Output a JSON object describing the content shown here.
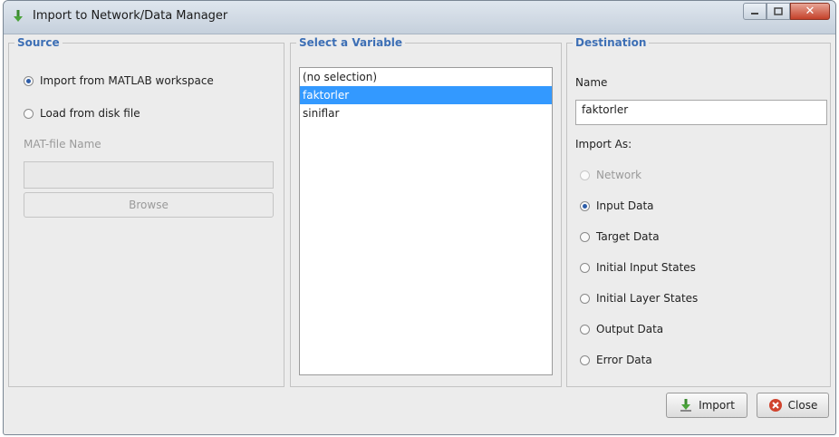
{
  "window": {
    "title": "Import to Network/Data Manager"
  },
  "source": {
    "title": "Source",
    "options": [
      {
        "label": "Import from MATLAB workspace",
        "checked": true
      },
      {
        "label": "Load from disk file",
        "checked": false
      }
    ],
    "matfile_label": "MAT-file Name",
    "matfile_value": "",
    "browse_label": "Browse"
  },
  "variables": {
    "title": "Select a Variable",
    "items": [
      "(no selection)",
      "faktorler",
      "siniflar"
    ],
    "selected": "faktorler"
  },
  "destination": {
    "title": "Destination",
    "name_label": "Name",
    "name_value": "faktorler",
    "import_as_label": "Import As:",
    "options": [
      {
        "label": "Network",
        "checked": false,
        "disabled": true
      },
      {
        "label": "Input Data",
        "checked": true,
        "disabled": false
      },
      {
        "label": "Target Data",
        "checked": false,
        "disabled": false
      },
      {
        "label": "Initial Input States",
        "checked": false,
        "disabled": false
      },
      {
        "label": "Initial Layer States",
        "checked": false,
        "disabled": false
      },
      {
        "label": "Output Data",
        "checked": false,
        "disabled": false
      },
      {
        "label": "Error Data",
        "checked": false,
        "disabled": false
      }
    ]
  },
  "buttons": {
    "import_label": "Import",
    "close_label": "Close"
  },
  "colors": {
    "section_title": "#3d6fb5",
    "selection": "#3399ff",
    "close_red": "#c4412a"
  },
  "icons": {
    "import": "import-arrow-icon",
    "close": "close-circle-icon"
  }
}
